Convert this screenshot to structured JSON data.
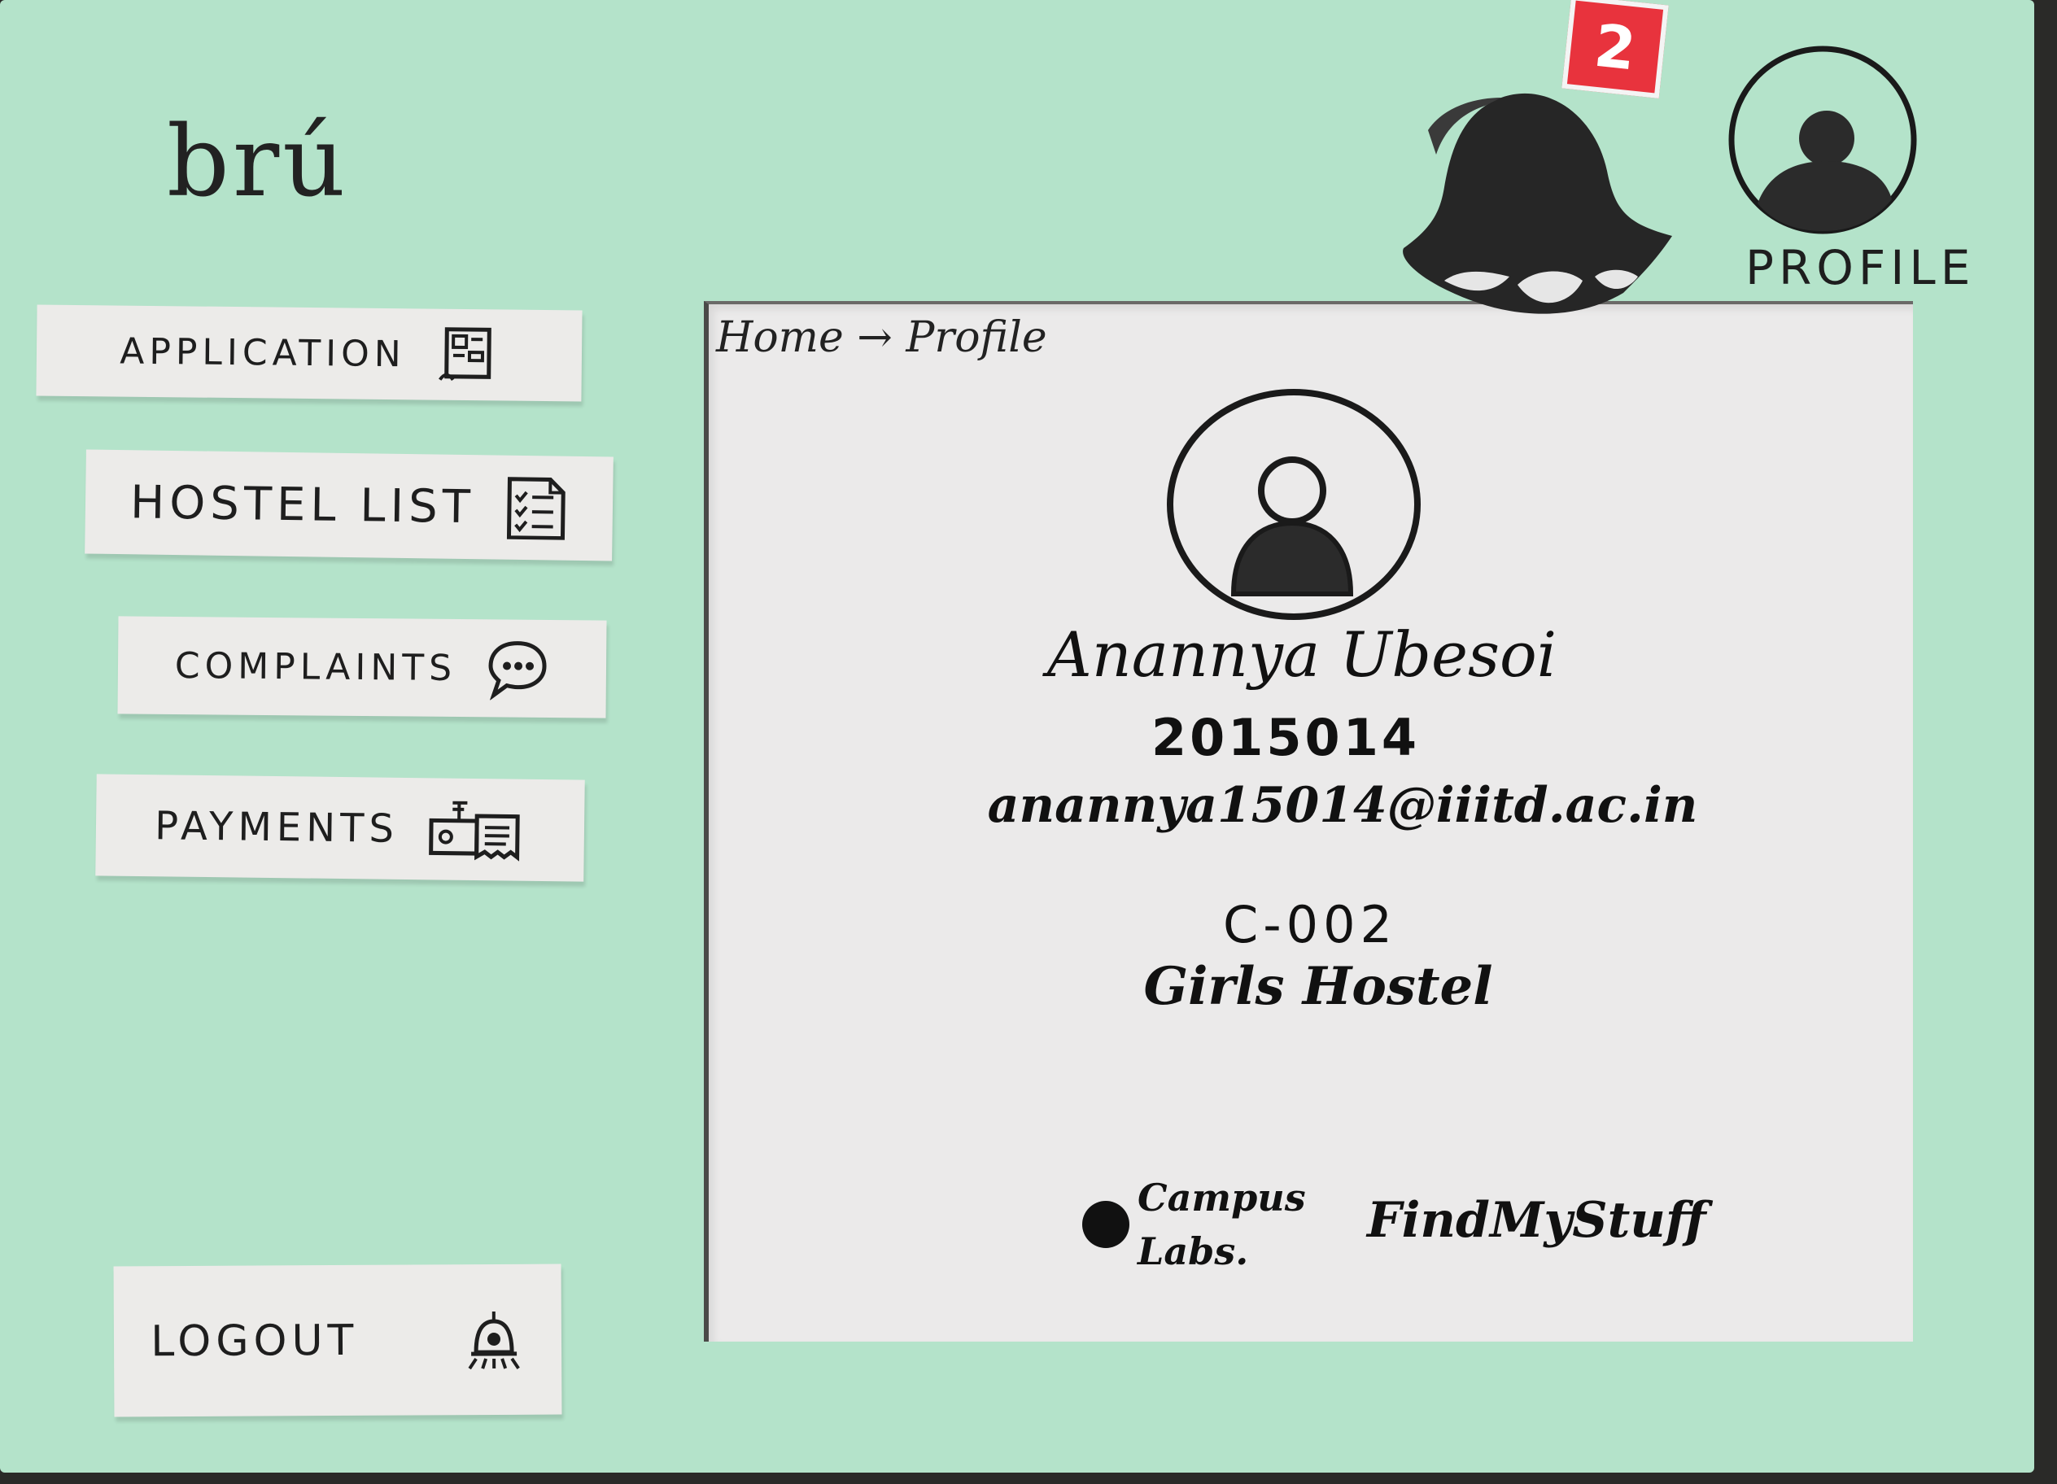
{
  "app": {
    "logo": "brú"
  },
  "header": {
    "notifications": {
      "icon": "bell-icon",
      "count": "2",
      "badge_color": "#e8333d"
    },
    "profile": {
      "icon": "user-avatar-icon",
      "label": "PROFILE"
    }
  },
  "sidebar": {
    "items": [
      {
        "label": "APPLICATION",
        "icon": "application-form-icon"
      },
      {
        "label": "HOSTEL LIST",
        "icon": "checklist-icon"
      },
      {
        "label": "COMPLAINTS",
        "icon": "chat-bubble-icon"
      },
      {
        "label": "PAYMENTS",
        "icon": "payment-receipt-icon"
      }
    ],
    "logout": {
      "label": "LOGOUT",
      "icon": "logout-alarm-icon"
    }
  },
  "main": {
    "breadcrumb": "Home → Profile",
    "profile": {
      "avatar_icon": "user-avatar-icon",
      "name": "Anannya Ubesoi",
      "id": "2015014",
      "email": "anannya15014@iiitd.ac.in",
      "room": "C-002",
      "hostel": "Girls Hostel"
    },
    "links": {
      "campus_labs": "Campus\nLabs.",
      "find_my_stuff": "FindMyStuff"
    }
  },
  "colors": {
    "background": "#b4e3ca",
    "paper": "#ebeaea",
    "ink": "#1c1c1c"
  }
}
